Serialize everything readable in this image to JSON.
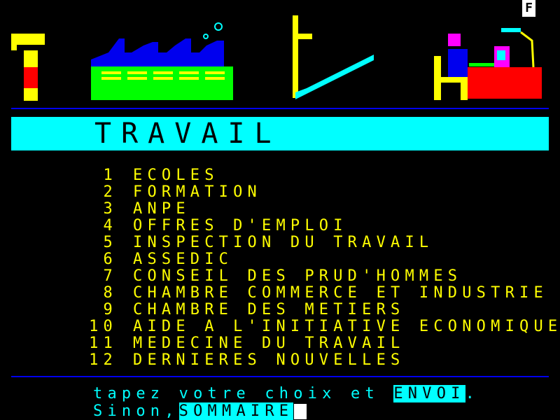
{
  "corner_key": "F",
  "header": {
    "illustrations": [
      "crane-icon",
      "factory-icon",
      "stairs-icon",
      "office-worker-icon"
    ],
    "colors": {
      "yellow": "#ffff00",
      "red": "#ff0000",
      "green": "#00ff00",
      "blue": "#0000ee",
      "cyan": "#00ffff",
      "magenta": "#ff00ff"
    }
  },
  "page_title": "TRAVAIL",
  "menu": [
    {
      "num": "1",
      "label": "ECOLES"
    },
    {
      "num": "2",
      "label": "FORMATION"
    },
    {
      "num": "3",
      "label": "ANPE"
    },
    {
      "num": "4",
      "label": "OFFRES D'EMPLOI"
    },
    {
      "num": "5",
      "label": "INSPECTION DU TRAVAIL"
    },
    {
      "num": "6",
      "label": "ASSEDIC"
    },
    {
      "num": "7",
      "label": "CONSEIL DES PRUD'HOMMES"
    },
    {
      "num": "8",
      "label": "CHAMBRE COMMERCE ET INDUSTRIE"
    },
    {
      "num": "9",
      "label": "CHAMBRE DES METIERS"
    },
    {
      "num": "10",
      "label": "AIDE A L'INITIATIVE ECONOMIQUE"
    },
    {
      "num": "11",
      "label": "MEDECINE DU TRAVAIL"
    },
    {
      "num": "12",
      "label": "DERNIERES NOUVELLES"
    }
  ],
  "prompt": {
    "line1_text": "tapez votre choix et ",
    "line1_key": "ENVOI",
    "line1_end": ".",
    "line2_text": "Sinon,",
    "line2_key": "SOMMAIRE",
    "line2_end": "."
  }
}
